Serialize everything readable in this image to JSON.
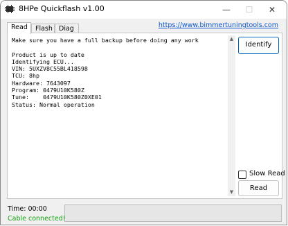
{
  "window": {
    "title": "8HPe Quickflash v1.00",
    "minimize_glyph": "—",
    "maximize_glyph": "☐",
    "close_glyph": "✕",
    "app_icon": "chip-icon"
  },
  "header": {
    "link_text": "https://www.bimmertuningtools.com"
  },
  "tabs": [
    {
      "label": "Read",
      "active": true
    },
    {
      "label": "Flash",
      "active": false
    },
    {
      "label": "Diag",
      "active": false
    }
  ],
  "output": {
    "lines": [
      "Make sure you have a full backup before doing any work",
      "",
      "Product is up to date",
      "Identifying ECU...",
      "VIN: 5UXZV8C55BL418598",
      "TCU: 8hp",
      "Hardware: 7643097",
      "Program: 0479U10K580Z",
      "Tune:    0479U10K580Z0XE01",
      "Status: Normal operation"
    ]
  },
  "scrollbar": {
    "up_icon": "scroll-up-arrow-icon",
    "down_icon": "scroll-down-arrow-icon"
  },
  "buttons": {
    "identify": "Identify",
    "read": "Read"
  },
  "options": {
    "slow_read_label": "Slow Read",
    "slow_read_checked": false
  },
  "status": {
    "time": "Time: 00:00",
    "connection": "Cable connected!",
    "connection_color": "#12a012"
  },
  "progress": {
    "fraction": 0,
    "fill_color": "#06b025"
  }
}
